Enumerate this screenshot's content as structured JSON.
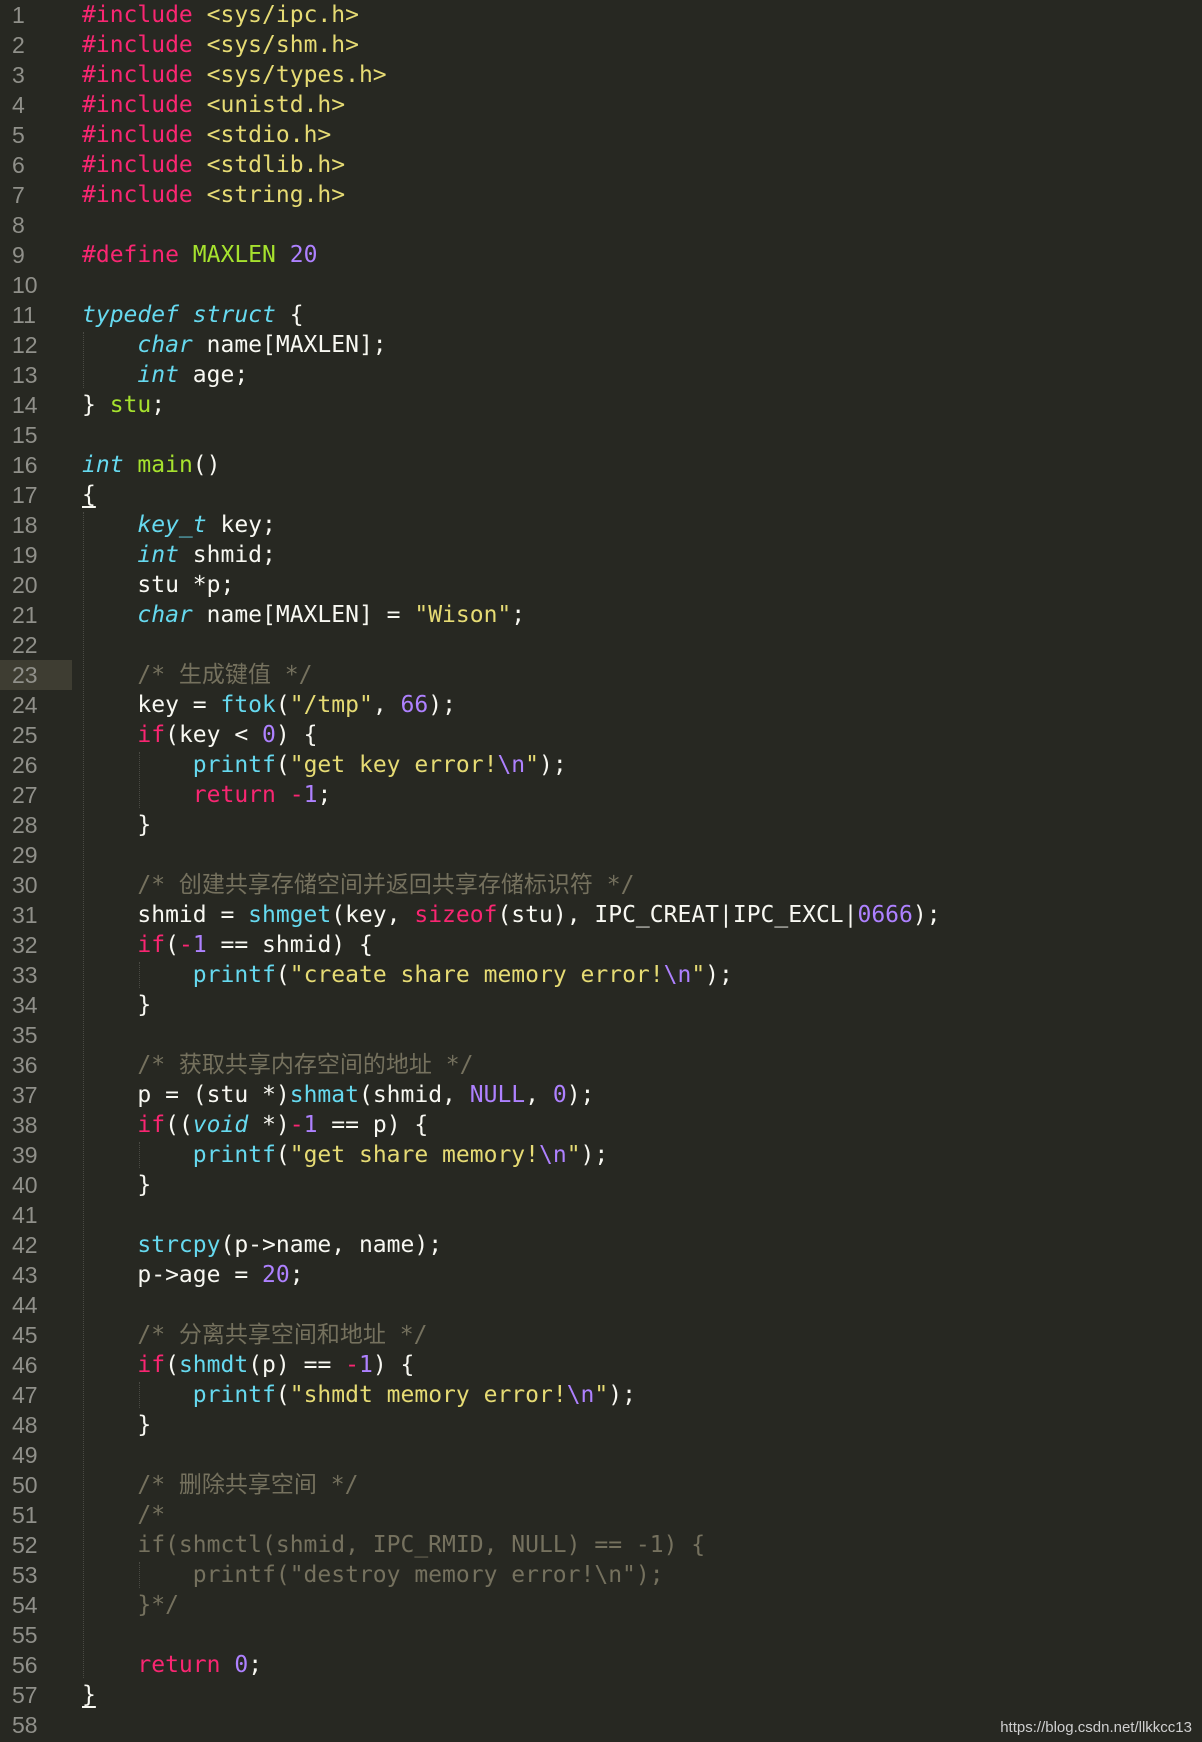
{
  "editor": {
    "current_line": 23,
    "theme_colors": {
      "background": "#272822",
      "gutter_text": "#90908a",
      "keyword": "#f92672",
      "string": "#e6db74",
      "number": "#ae81ff",
      "type": "#66d9ef",
      "function_name": "#a6e22e",
      "comment": "#75715e",
      "plain": "#f8f8f2"
    },
    "lines": [
      [
        [
          "kw",
          "#include"
        ],
        [
          "pl",
          " "
        ],
        [
          "str",
          "<sys/ipc.h>"
        ]
      ],
      [
        [
          "kw",
          "#include"
        ],
        [
          "pl",
          " "
        ],
        [
          "str",
          "<sys/shm.h>"
        ]
      ],
      [
        [
          "kw",
          "#include"
        ],
        [
          "pl",
          " "
        ],
        [
          "str",
          "<sys/types.h>"
        ]
      ],
      [
        [
          "kw",
          "#include"
        ],
        [
          "pl",
          " "
        ],
        [
          "str",
          "<unistd.h>"
        ]
      ],
      [
        [
          "kw",
          "#include"
        ],
        [
          "pl",
          " "
        ],
        [
          "str",
          "<stdio.h>"
        ]
      ],
      [
        [
          "kw",
          "#include"
        ],
        [
          "pl",
          " "
        ],
        [
          "str",
          "<stdlib.h>"
        ]
      ],
      [
        [
          "kw",
          "#include"
        ],
        [
          "pl",
          " "
        ],
        [
          "str",
          "<string.h>"
        ]
      ],
      [],
      [
        [
          "kw",
          "#define"
        ],
        [
          "pl",
          " "
        ],
        [
          "fn",
          "MAXLEN"
        ],
        [
          "pl",
          " "
        ],
        [
          "num",
          "20"
        ]
      ],
      [],
      [
        [
          "typ",
          "typedef"
        ],
        [
          "pl",
          " "
        ],
        [
          "typ",
          "struct"
        ],
        [
          "pl",
          " {"
        ]
      ],
      [
        [
          "pl",
          "    "
        ],
        [
          "typ",
          "char"
        ],
        [
          "pl",
          " name[MAXLEN];"
        ]
      ],
      [
        [
          "pl",
          "    "
        ],
        [
          "typ",
          "int"
        ],
        [
          "pl",
          " age;"
        ]
      ],
      [
        [
          "pl",
          "} "
        ],
        [
          "fn",
          "stu"
        ],
        [
          "pl",
          ";"
        ]
      ],
      [],
      [
        [
          "typ",
          "int"
        ],
        [
          "pl",
          " "
        ],
        [
          "fn",
          "main"
        ],
        [
          "pl",
          "()"
        ]
      ],
      [
        [
          "pl brace-ul",
          "{"
        ]
      ],
      [
        [
          "pl",
          "    "
        ],
        [
          "typ",
          "key_t"
        ],
        [
          "pl",
          " key;"
        ]
      ],
      [
        [
          "pl",
          "    "
        ],
        [
          "typ",
          "int"
        ],
        [
          "pl",
          " shmid;"
        ]
      ],
      [
        [
          "pl",
          "    stu *p;"
        ]
      ],
      [
        [
          "pl",
          "    "
        ],
        [
          "typ",
          "char"
        ],
        [
          "pl",
          " name[MAXLEN] = "
        ],
        [
          "str",
          "\"Wison\""
        ],
        [
          "pl",
          ";"
        ]
      ],
      [],
      [
        [
          "pl",
          "    "
        ],
        [
          "com",
          "/* 生成键值 */"
        ]
      ],
      [
        [
          "pl",
          "    key = "
        ],
        [
          "call",
          "ftok"
        ],
        [
          "pl",
          "("
        ],
        [
          "str",
          "\"/tmp\""
        ],
        [
          "pl",
          ", "
        ],
        [
          "num",
          "66"
        ],
        [
          "pl",
          ");"
        ]
      ],
      [
        [
          "pl",
          "    "
        ],
        [
          "kw",
          "if"
        ],
        [
          "pl",
          "(key < "
        ],
        [
          "num",
          "0"
        ],
        [
          "pl",
          ") {"
        ]
      ],
      [
        [
          "pl",
          "        "
        ],
        [
          "call",
          "printf"
        ],
        [
          "pl",
          "("
        ],
        [
          "str",
          "\"get key error!"
        ],
        [
          "num",
          "\\n"
        ],
        [
          "str",
          "\""
        ],
        [
          "pl",
          ");"
        ]
      ],
      [
        [
          "pl",
          "        "
        ],
        [
          "kw",
          "return"
        ],
        [
          "pl",
          " "
        ],
        [
          "kw",
          "-"
        ],
        [
          "num",
          "1"
        ],
        [
          "pl",
          ";"
        ]
      ],
      [
        [
          "pl",
          "    }"
        ]
      ],
      [],
      [
        [
          "pl",
          "    "
        ],
        [
          "com",
          "/* 创建共享存储空间并返回共享存储标识符 */"
        ]
      ],
      [
        [
          "pl",
          "    shmid = "
        ],
        [
          "call",
          "shmget"
        ],
        [
          "pl",
          "(key, "
        ],
        [
          "kw",
          "sizeof"
        ],
        [
          "pl",
          "(stu), IPC_CREAT|IPC_EXCL|"
        ],
        [
          "num",
          "0666"
        ],
        [
          "pl",
          ");"
        ]
      ],
      [
        [
          "pl",
          "    "
        ],
        [
          "kw",
          "if"
        ],
        [
          "pl",
          "("
        ],
        [
          "kw",
          "-"
        ],
        [
          "num",
          "1"
        ],
        [
          "pl",
          " == shmid) {"
        ]
      ],
      [
        [
          "pl",
          "        "
        ],
        [
          "call",
          "printf"
        ],
        [
          "pl",
          "("
        ],
        [
          "str",
          "\"create share memory error!"
        ],
        [
          "num",
          "\\n"
        ],
        [
          "str",
          "\""
        ],
        [
          "pl",
          ");"
        ]
      ],
      [
        [
          "pl",
          "    }"
        ]
      ],
      [],
      [
        [
          "pl",
          "    "
        ],
        [
          "com",
          "/* 获取共享内存空间的地址 */"
        ]
      ],
      [
        [
          "pl",
          "    p = (stu *)"
        ],
        [
          "call",
          "shmat"
        ],
        [
          "pl",
          "(shmid, "
        ],
        [
          "num",
          "NULL"
        ],
        [
          "pl",
          ", "
        ],
        [
          "num",
          "0"
        ],
        [
          "pl",
          ");"
        ]
      ],
      [
        [
          "pl",
          "    "
        ],
        [
          "kw",
          "if"
        ],
        [
          "pl",
          "(("
        ],
        [
          "typ",
          "void"
        ],
        [
          "pl",
          " *)"
        ],
        [
          "kw",
          "-"
        ],
        [
          "num",
          "1"
        ],
        [
          "pl",
          " == p) {"
        ]
      ],
      [
        [
          "pl",
          "        "
        ],
        [
          "call",
          "printf"
        ],
        [
          "pl",
          "("
        ],
        [
          "str",
          "\"get share memory!"
        ],
        [
          "num",
          "\\n"
        ],
        [
          "str",
          "\""
        ],
        [
          "pl",
          ");"
        ]
      ],
      [
        [
          "pl",
          "    }"
        ]
      ],
      [],
      [
        [
          "pl",
          "    "
        ],
        [
          "call",
          "strcpy"
        ],
        [
          "pl",
          "(p->name, name);"
        ]
      ],
      [
        [
          "pl",
          "    p->age = "
        ],
        [
          "num",
          "20"
        ],
        [
          "pl",
          ";"
        ]
      ],
      [],
      [
        [
          "pl",
          "    "
        ],
        [
          "com",
          "/* 分离共享空间和地址 */"
        ]
      ],
      [
        [
          "pl",
          "    "
        ],
        [
          "kw",
          "if"
        ],
        [
          "pl",
          "("
        ],
        [
          "call",
          "shmdt"
        ],
        [
          "pl",
          "(p) == "
        ],
        [
          "kw",
          "-"
        ],
        [
          "num",
          "1"
        ],
        [
          "pl",
          ") {"
        ]
      ],
      [
        [
          "pl",
          "        "
        ],
        [
          "call",
          "printf"
        ],
        [
          "pl",
          "("
        ],
        [
          "str",
          "\"shmdt memory error!"
        ],
        [
          "num",
          "\\n"
        ],
        [
          "str",
          "\""
        ],
        [
          "pl",
          ");"
        ]
      ],
      [
        [
          "pl",
          "    }"
        ]
      ],
      [],
      [
        [
          "pl",
          "    "
        ],
        [
          "com",
          "/* 删除共享空间 */"
        ]
      ],
      [
        [
          "pl",
          "    "
        ],
        [
          "com",
          "/*"
        ]
      ],
      [
        [
          "pl",
          "    "
        ],
        [
          "com",
          "if(shmctl(shmid, IPC_RMID, NULL) == -1) {"
        ]
      ],
      [
        [
          "pl",
          "        "
        ],
        [
          "com",
          "printf(\"destroy memory error!\\n\");"
        ]
      ],
      [
        [
          "pl",
          "    "
        ],
        [
          "com",
          "}*/"
        ]
      ],
      [],
      [
        [
          "pl",
          "    "
        ],
        [
          "kw",
          "return"
        ],
        [
          "pl",
          " "
        ],
        [
          "num",
          "0"
        ],
        [
          "pl",
          ";"
        ]
      ],
      [
        [
          "pl brace-ul",
          "}"
        ]
      ],
      []
    ]
  },
  "watermark": "https://blog.csdn.net/llkkcc13"
}
